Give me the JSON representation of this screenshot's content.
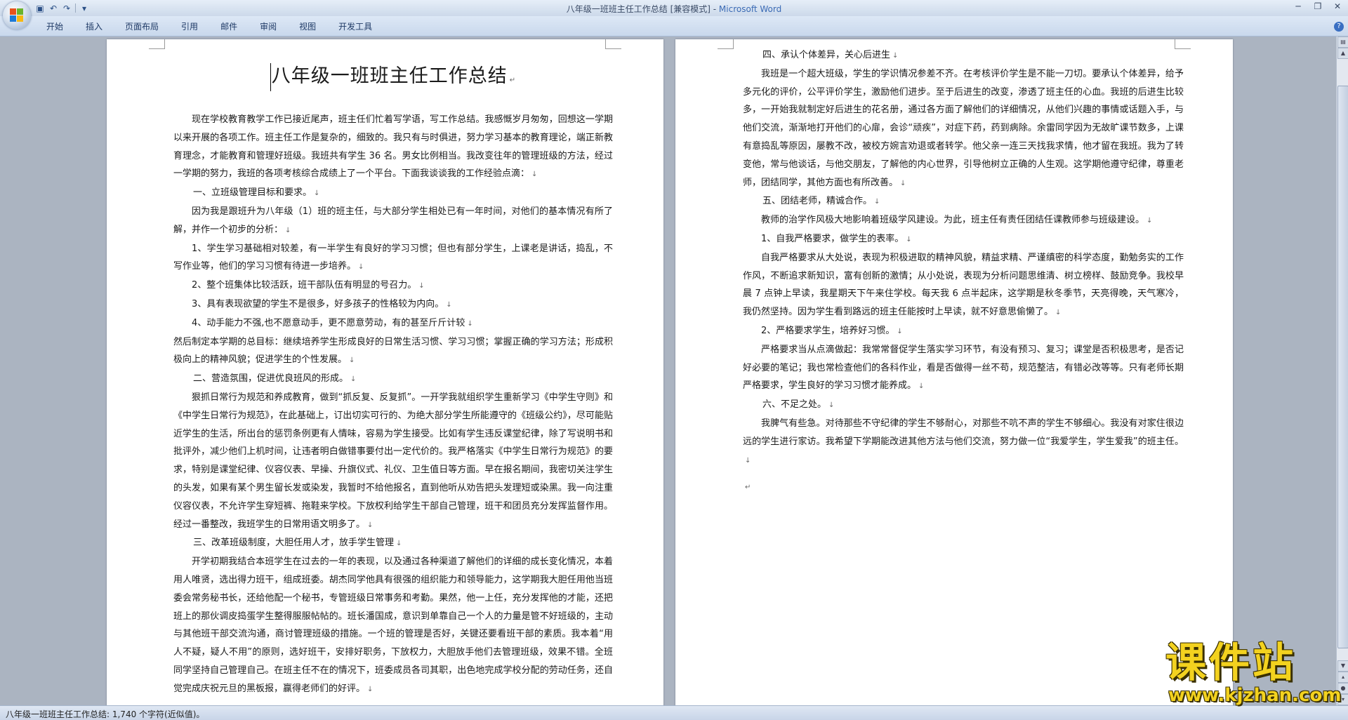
{
  "window": {
    "title_doc": "八年级一班班主任工作总结 [兼容模式] - ",
    "title_app": "Microsoft Word"
  },
  "ribbon": {
    "tabs": [
      "开始",
      "插入",
      "页面布局",
      "引用",
      "邮件",
      "审阅",
      "视图",
      "开发工具"
    ]
  },
  "left_page": {
    "heading": "八年级一班班主任工作总结",
    "paragraphs": [
      {
        "style": "ind",
        "text": "现在学校教育教学工作已接近尾声，班主任们忙着写学语，写工作总结。我感慨岁月匆匆，回想这一学期以来开展的各项工作。班主任工作是复杂的，细致的。我只有与时俱进，努力学习基本的教育理论，端正新教育理念，才能教育和管理好班级。我班共有学生 36 名。男女比例相当。我改变往年的管理班级的方法，经过一学期的努力，我班的各项考核综合成绩上了一个平台。下面我谈谈我的工作经验点滴："
      },
      {
        "style": "sec",
        "text": "一、立班级管理目标和要求。"
      },
      {
        "style": "ind",
        "text": "因为我是跟班升为八年级（1）班的班主任，与大部分学生相处已有一年时间，对他们的基本情况有所了解，并作一个初步的分析："
      },
      {
        "style": "ind",
        "text": "1、学生学习基础相对较差，有一半学生有良好的学习习惯；但也有部分学生，上课老是讲话，捣乱，不写作业等，他们的学习习惯有待进一步培养。"
      },
      {
        "style": "ind",
        "text": "2、整个班集体比较活跃，班干部队伍有明显的号召力。"
      },
      {
        "style": "ind",
        "text": "3、具有表现欲望的学生不是很多，好多孩子的性格较为内向。"
      },
      {
        "style": "ind",
        "text": "4、动手能力不强,也不愿意动手，更不愿意劳动，有的甚至斤斤计较"
      },
      {
        "style": "plain",
        "text": "然后制定本学期的总目标：继续培养学生形成良好的日常生活习惯、学习习惯；掌握正确的学习方法；形成积极向上的精神风貌；促进学生的个性发展。"
      },
      {
        "style": "sec",
        "text": "二、营造氛围，促进优良班风的形成。"
      },
      {
        "style": "ind",
        "text": "狠抓日常行为规范和养成教育，做到“抓反复、反复抓”。一开学我就组织学生重新学习《中学生守则》和《中学生日常行为规范》，在此基础上，订出切实可行的、为绝大部分学生所能遵守的《班级公约》，尽可能贴近学生的生活，所出台的惩罚条例更有人情味，容易为学生接受。比如有学生违反课堂纪律，除了写说明书和批评外，减少他们上机时间，让违者明白做错事要付出一定代价的。我严格落实《中学生日常行为规范》的要求，特别是课堂纪律、仪容仪表、早操、升旗仪式、礼仪、卫生值日等方面。早在报名期间，我密切关注学生的头发，如果有某个男生留长发或染发，我暂时不给他报名，直到他听从劝告把头发理短或染黑。我一向注重仪容仪表，不允许学生穿短裤、拖鞋来学校。下放权利给学生干部自己管理，班干和团员充分发挥监督作用。经过一番整改，我班学生的日常用语文明多了。"
      },
      {
        "style": "sec",
        "text": "三、改革班级制度，大胆任用人才，放手学生管理"
      },
      {
        "style": "ind",
        "text": "开学初期我结合本班学生在过去的一年的表现，以及通过各种渠道了解他们的详细的成长变化情况，本着用人唯贤，选出得力班干，组成班委。胡杰同学他具有很强的组织能力和领导能力，这学期我大胆任用他当班委会常务秘书长，还给他配一个秘书，专管班级日常事务和考勤。果然，他一上任，充分发挥他的才能，还把班上的那伙调皮捣蛋学生整得服服帖帖的。班长潘国成，意识到单靠自己一个人的力量是管不好班级的，主动与其他班干部交流沟通，商讨管理班级的措施。一个班的管理是否好，关键还要看班干部的素质。我本着“用人不疑，疑人不用”的原则，选好班干，安排好职务，下放权力，大胆放手他们去管理班级，效果不错。全班同学坚持自己管理自己。在班主任不在的情况下，班委成员各司其职，出色地完成学校分配的劳动任务，还自觉完成庆祝元旦的黑板报，赢得老师们的好评。"
      }
    ]
  },
  "right_page": {
    "paragraphs": [
      {
        "style": "sec",
        "text": "四、承认个体差异，关心后进生"
      },
      {
        "style": "ind",
        "text": "我班是一个超大班级，学生的学识情况参差不齐。在考核评价学生是不能一刀切。要承认个体差异，给予多元化的评价，公平评价学生，激励他们进步。至于后进生的改变，渗透了班主任的心血。我班的后进生比较多，一开始我就制定好后进生的花名册，通过各方面了解他们的详细情况，从他们兴趣的事情或话题入手，与他们交流，渐渐地打开他们的心扉，会诊“顽疾”，对症下药，药到病除。余雷同学因为无故旷课节数多，上课有意捣乱等原因，屡教不改，被校方婉言劝退或者转学。他父亲一连三天找我求情，他才留在我班。我为了转变他，常与他谈话，与他交朋友，了解他的内心世界，引导他树立正确的人生观。这学期他遵守纪律，尊重老师，团结同学，其他方面也有所改善。"
      },
      {
        "style": "sec",
        "text": "五、团结老师，精诚合作。"
      },
      {
        "style": "ind",
        "text": "教师的治学作风极大地影响着班级学风建设。为此，班主任有责任团结任课教师参与班级建设。"
      },
      {
        "style": "ind",
        "text": "1、自我严格要求，做学生的表率。"
      },
      {
        "style": "ind",
        "text": "自我严格要求从大处说，表现为积极进取的精神风貌，精益求精、严谨缜密的科学态度，勤勉务实的工作作风，不断追求新知识，富有创新的激情；从小处说，表现为分析问题思维清、树立榜样、鼓励竞争。我校早晨 7 点钟上早读，我星期天下午来住学校。每天我 6 点半起床，这学期是秋冬季节，天亮得晚，天气寒冷，我仍然坚持。因为学生看到路远的班主任能按时上早读，就不好意思偷懒了。"
      },
      {
        "style": "ind",
        "text": "2、严格要求学生，培养好习惯。"
      },
      {
        "style": "ind",
        "text": "严格要求当从点滴做起：我常常督促学生落实学习环节，有没有预习、复习；课堂是否积极思考，是否记好必要的笔记；我也常检查他们的各科作业，看是否做得一丝不苟，规范整洁，有错必改等等。只有老师长期严格要求，学生良好的学习习惯才能养成。"
      },
      {
        "style": "sec",
        "text": "六、不足之处。"
      },
      {
        "style": "ind",
        "text": "我脾气有些急。对待那些不守纪律的学生不够耐心，对那些不吭不声的学生不够细心。我没有对家住很边远的学生进行家访。我希望下学期能改进其他方法与他们交流，努力做一位“我爱学生，学生爱我”的班主任。"
      }
    ]
  },
  "status": {
    "text": "八年级一班班主任工作总结: 1,740 个字符(近似值)。"
  },
  "watermark": {
    "main": "课件站",
    "url": "www.kjzhan.com"
  },
  "icons": {
    "office_button": "office-button-icon",
    "para_mark": "↓",
    "end_mark": "↵"
  },
  "colors": {
    "app_title": "#3b6bb5",
    "watermark": "#f3d21f",
    "workspace": "#abb4c1"
  }
}
